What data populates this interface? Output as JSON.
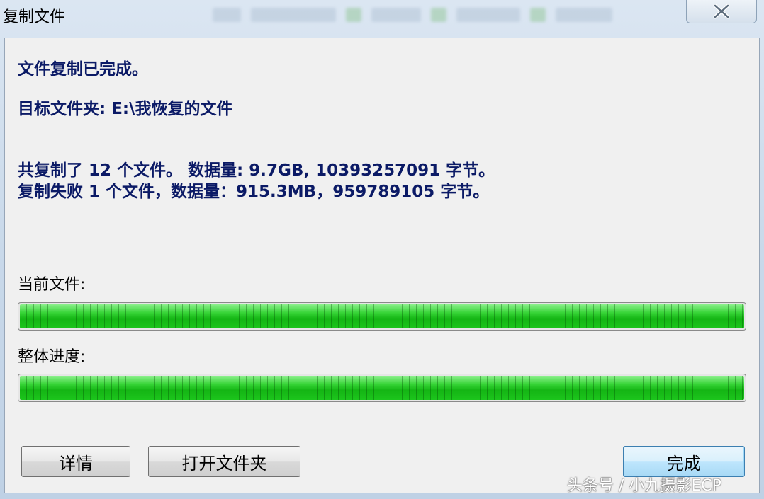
{
  "window": {
    "title": "复制文件",
    "close_icon": "close-x-icon"
  },
  "messages": {
    "complete": "文件复制已完成。",
    "target": "目标文件夹: E:\\我恢复的文件",
    "copied": "共复制了 12 个文件。 数据量: 9.7GB, 10393257091 字节。",
    "failed": "复制失败 1 个文件，数据量：915.3MB，959789105 字节。"
  },
  "progress": {
    "current_label": "当前文件:",
    "current_value": 1.0,
    "overall_label": "整体进度:",
    "overall_value": 1.0,
    "bar_color": "#1cc51c"
  },
  "buttons": {
    "details": "详情",
    "open_folder": "打开文件夹",
    "finish": "完成"
  },
  "watermark": "头条号 / 小九摄影ECP"
}
